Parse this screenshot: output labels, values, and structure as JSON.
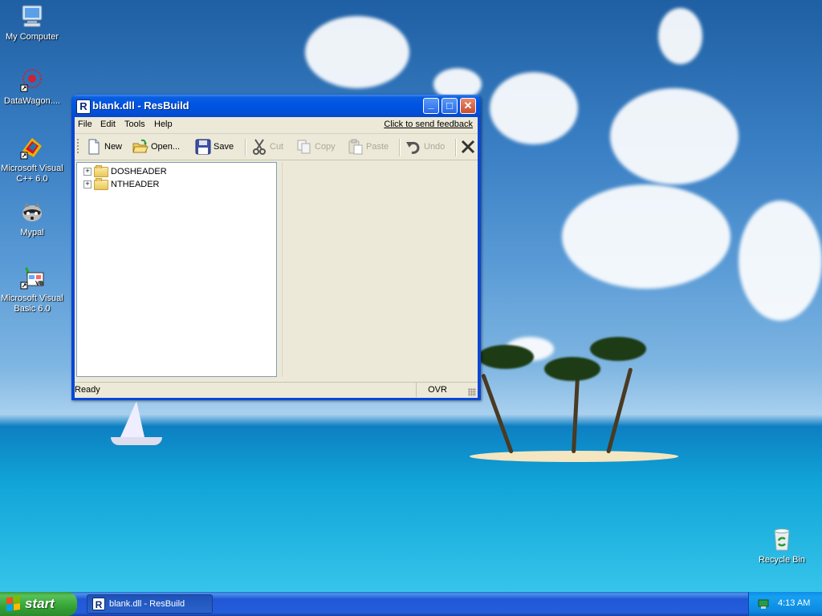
{
  "desktop": {
    "icons": [
      {
        "label": "My Computer"
      },
      {
        "label": "DataWagon...."
      },
      {
        "label": "Microsoft Visual C++ 6.0"
      },
      {
        "label": "Mypal"
      },
      {
        "label": "Microsoft Visual Basic 6.0"
      },
      {
        "label": "Recycle Bin"
      }
    ]
  },
  "window": {
    "title": "blank.dll - ResBuild",
    "app_icon_letter": "R",
    "controls": {
      "minimize": "_",
      "maximize": "□",
      "close": "✕"
    },
    "menu": [
      "File",
      "Edit",
      "Tools",
      "Help"
    ],
    "feedback_link": "Click to send feedback",
    "toolbar": {
      "new": "New",
      "open": "Open...",
      "save": "Save",
      "cut": "Cut",
      "copy": "Copy",
      "paste": "Paste",
      "undo": "Undo"
    },
    "tree": [
      {
        "label": "DOSHEADER",
        "expander": "+"
      },
      {
        "label": "NTHEADER",
        "expander": "+"
      }
    ],
    "status": {
      "text": "Ready",
      "ovr": "OVR"
    }
  },
  "taskbar": {
    "start_label": "start",
    "task_button": "blank.dll - ResBuild",
    "clock": "4:13 AM"
  },
  "colors": {
    "titlebar": "#0054e3",
    "taskbar": "#245edc",
    "start_button": "#36a436"
  }
}
